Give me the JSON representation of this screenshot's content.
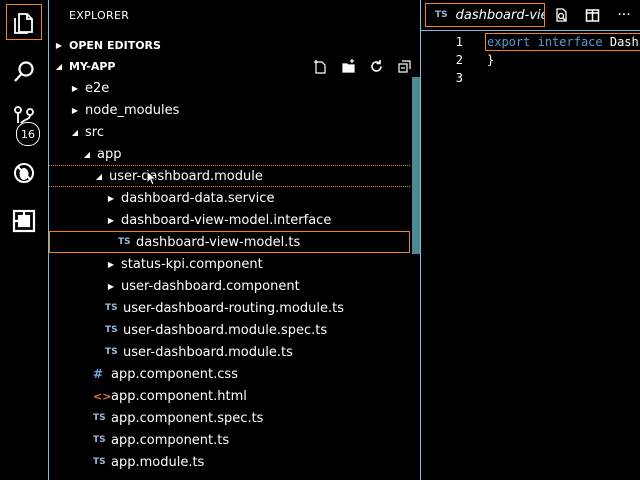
{
  "activity_bar": {
    "items": [
      {
        "icon": "files-icon",
        "active": true
      },
      {
        "icon": "search-icon"
      },
      {
        "icon": "source-control-icon",
        "badge": "16"
      },
      {
        "icon": "debug-icon"
      },
      {
        "icon": "extensions-icon"
      }
    ]
  },
  "explorer": {
    "title": "EXPLORER",
    "open_editors_label": "OPEN EDITORS",
    "project_label": "MY-APP",
    "tree": [
      {
        "label": "e2e",
        "depth": 0,
        "type": "folder",
        "expanded": false
      },
      {
        "label": "node_modules",
        "depth": 0,
        "type": "folder",
        "expanded": false
      },
      {
        "label": "src",
        "depth": 0,
        "type": "folder",
        "expanded": true
      },
      {
        "label": "app",
        "depth": 1,
        "type": "folder",
        "expanded": true
      },
      {
        "label": "user-dashboard.module",
        "depth": 2,
        "type": "folder",
        "expanded": true,
        "state": "hover"
      },
      {
        "label": "dashboard-data.service",
        "depth": 3,
        "type": "folder",
        "expanded": false
      },
      {
        "label": "dashboard-view-model.interface",
        "depth": 3,
        "type": "folder",
        "expanded": false
      },
      {
        "label": "dashboard-view-model.ts",
        "depth": 4,
        "type": "ts",
        "state": "focused"
      },
      {
        "label": "status-kpi.component",
        "depth": 3,
        "type": "folder",
        "expanded": false
      },
      {
        "label": "user-dashboard.component",
        "depth": 3,
        "type": "folder",
        "expanded": false
      },
      {
        "label": "user-dashboard-routing.module.ts",
        "depth": 3,
        "type": "ts"
      },
      {
        "label": "user-dashboard.module.spec.ts",
        "depth": 3,
        "type": "ts"
      },
      {
        "label": "user-dashboard.module.ts",
        "depth": 3,
        "type": "ts"
      },
      {
        "label": "app.component.css",
        "depth": 2,
        "type": "css"
      },
      {
        "label": "app.component.html",
        "depth": 2,
        "type": "html"
      },
      {
        "label": "app.component.spec.ts",
        "depth": 2,
        "type": "ts"
      },
      {
        "label": "app.component.ts",
        "depth": 2,
        "type": "ts"
      },
      {
        "label": "app.module.ts",
        "depth": 2,
        "type": "ts"
      }
    ]
  },
  "editor": {
    "tab": {
      "badge": "TS",
      "name": "dashboard-view-model.ts"
    },
    "lines": [
      {
        "number": "1",
        "keyword1": "export",
        "keyword2": "interface",
        "rest": " Dash"
      },
      {
        "number": "2",
        "rest": "}"
      },
      {
        "number": "3",
        "rest": ""
      }
    ]
  },
  "colors": {
    "focus": "#f38518",
    "contrast_border": "#6fc3df",
    "keyword": "#569cd6"
  }
}
